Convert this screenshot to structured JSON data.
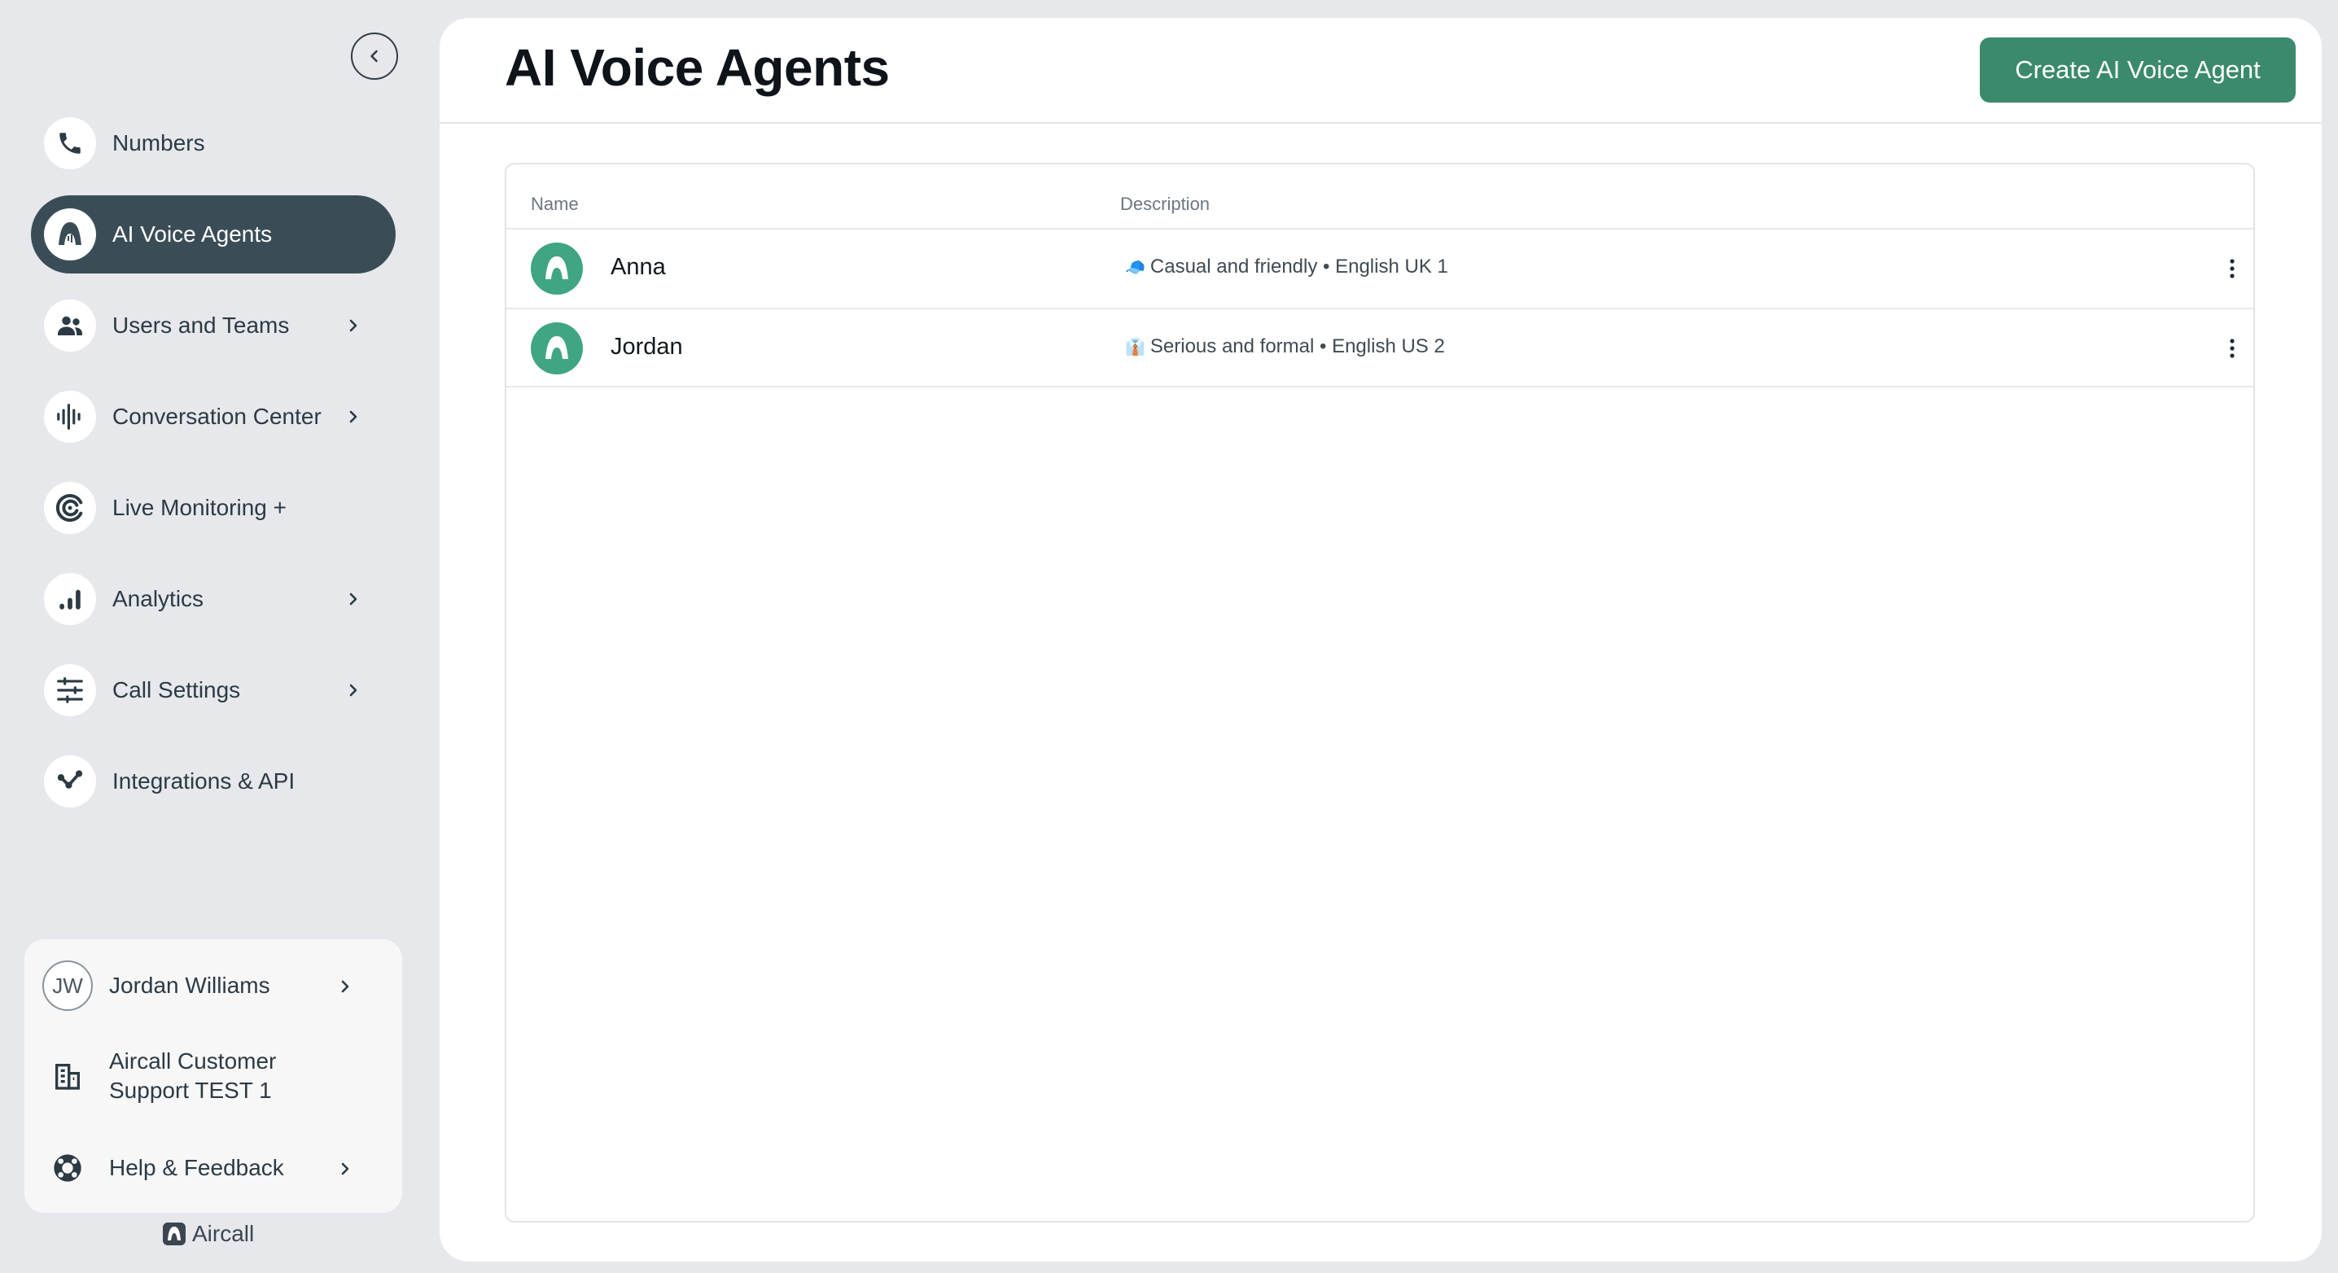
{
  "sidebar": {
    "items": [
      {
        "label": "Numbers",
        "icon": "phone-icon"
      },
      {
        "label": "AI Voice Agents",
        "icon": "aircall-agent-icon",
        "active": true
      },
      {
        "label": "Users and Teams",
        "icon": "users-icon",
        "has_submenu": true
      },
      {
        "label": "Conversation Center",
        "icon": "waveform-icon",
        "has_submenu": true
      },
      {
        "label": "Live Monitoring +",
        "icon": "live-monitoring-icon"
      },
      {
        "label": "Analytics",
        "icon": "bar-chart-icon",
        "has_submenu": true
      },
      {
        "label": "Call Settings",
        "icon": "sliders-icon",
        "has_submenu": true
      },
      {
        "label": "Integrations & API",
        "icon": "integration-icon"
      }
    ],
    "account": {
      "user_initials": "JW",
      "user_name": "Jordan Williams",
      "company": "Aircall Customer Support TEST 1",
      "help": "Help & Feedback"
    },
    "brand": "Aircall"
  },
  "main": {
    "title": "AI Voice Agents",
    "create_button": "Create AI Voice Agent",
    "columns": {
      "name": "Name",
      "description": "Description"
    },
    "rows": [
      {
        "name": "Anna",
        "emoji": "🧢",
        "description": "Casual and friendly • English UK 1"
      },
      {
        "name": "Jordan",
        "emoji": "👔",
        "description": "Serious and formal • English US 2"
      }
    ]
  },
  "colors": {
    "accent": "#3a8a6b",
    "sidebar_active": "#3a4d57",
    "avatar_green": "#3fa583",
    "background": "#e6e8eb"
  }
}
